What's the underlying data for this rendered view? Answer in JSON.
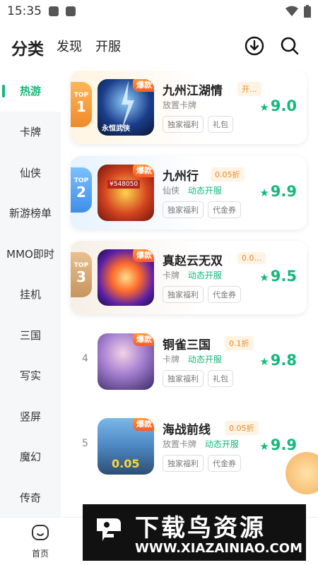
{
  "status_bar": {
    "time": "15:35"
  },
  "header": {
    "tabs": [
      {
        "label": "分类",
        "active": true
      },
      {
        "label": "发现",
        "active": false
      },
      {
        "label": "开服",
        "active": false
      }
    ],
    "download_icon": "download-icon",
    "search_icon": "search-icon"
  },
  "sidebar": {
    "items": [
      "热游",
      "卡牌",
      "仙侠",
      "新游榜单",
      "MMO即时",
      "挂机",
      "三国",
      "写实",
      "竖屏",
      "魔幻",
      "传奇"
    ],
    "active_index": 0
  },
  "games": [
    {
      "rank": "1",
      "top_label": "TOP",
      "hot": "爆款",
      "name": "九州江湖情",
      "discount": "开...",
      "category": "放置卡牌",
      "dynamic": "",
      "tags": [
        "独家福利",
        "礼包"
      ],
      "score": "9.0",
      "image_text": "永恒武侠"
    },
    {
      "rank": "2",
      "top_label": "TOP",
      "hot": "爆款",
      "name": "九州行",
      "discount": "0.05折",
      "category": "仙侠",
      "dynamic": "动态开服",
      "tags": [
        "独家福利",
        "代金券"
      ],
      "score": "9.9",
      "image_text": "¥548050"
    },
    {
      "rank": "3",
      "top_label": "TOP",
      "hot": "爆款",
      "name": "真赵云无双",
      "discount": "0.0...",
      "category": "卡牌",
      "dynamic": "动态开服",
      "tags": [
        "独家福利",
        "代金券"
      ],
      "score": "9.5",
      "image_text": ""
    },
    {
      "rank": "4",
      "top_label": "",
      "hot": "爆款",
      "name": "铜雀三国",
      "discount": "0.1折",
      "category": "卡牌",
      "dynamic": "动态开服",
      "tags": [
        "独家福利",
        "礼包"
      ],
      "score": "9.8",
      "image_text": ""
    },
    {
      "rank": "5",
      "top_label": "",
      "hot": "爆款",
      "name": "海战前线",
      "discount": "0.05折",
      "category": "放置卡牌",
      "dynamic": "动态开服",
      "tags": [
        "独家福利",
        "代金券"
      ],
      "score": "9.9",
      "image_text": "0.05"
    }
  ],
  "score_star": "★",
  "bottom_nav": {
    "home_label": "首页"
  },
  "watermark": {
    "title": "下载鸟资源",
    "url": "WWW.XIAZAINIAO.COM"
  },
  "colors": {
    "accent": "#12b97a",
    "discount": "#e88a2a",
    "top1": "#f5a03c",
    "top2": "#4aa3f0",
    "top3": "#d9a56b"
  }
}
